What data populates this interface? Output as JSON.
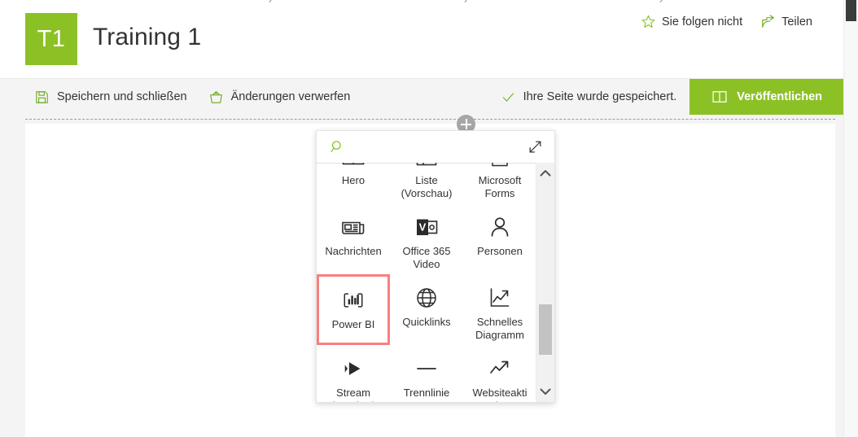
{
  "window": {
    "clipped_top_text": "..."
  },
  "site_header": {
    "logo_initials": "T1",
    "logo_color": "#8cc126",
    "title": "Training 1",
    "actions": [
      {
        "label": "Sie folgen nicht",
        "icon": "star-outline-icon"
      },
      {
        "label": "Teilen",
        "icon": "share-icon"
      }
    ]
  },
  "command_bar": {
    "items": [
      {
        "label": "Speichern und schließen",
        "icon": "save-icon"
      },
      {
        "label": "Änderungen verwerfen",
        "icon": "discard-icon"
      }
    ],
    "save_status": {
      "label": "Ihre Seite wurde gespeichert.",
      "icon": "checkmark-icon"
    },
    "publish": {
      "label": "Veröffentlichen",
      "icon": "publish-book-icon",
      "color": "#8cc126"
    }
  },
  "canvas": {
    "add_section_button": "add-section-icon"
  },
  "picker": {
    "search": {
      "value": "",
      "placeholder": "",
      "icon": "search-icon",
      "expand_icon": "expand-diagonal-icon"
    },
    "selection_color": "#f97f7f",
    "selected_index": 6,
    "webparts": [
      {
        "label": "Hero",
        "icon": "hero-icon"
      },
      {
        "label": "Liste\n(Vorschau)",
        "icon": "list-icon"
      },
      {
        "label": "Microsoft\nForms",
        "icon": "forms-icon"
      },
      {
        "label": "Nachrichten",
        "icon": "news-icon"
      },
      {
        "label": "Office 365\nVideo",
        "icon": "office-video-icon"
      },
      {
        "label": "Personen",
        "icon": "person-icon"
      },
      {
        "label": "Power BI",
        "icon": "power-bi-icon"
      },
      {
        "label": "Quicklinks",
        "icon": "globe-icon"
      },
      {
        "label": "Schnelles\nDiagramm",
        "icon": "quick-chart-icon"
      },
      {
        "label": "Stream\n(Preview)",
        "icon": "stream-play-icon"
      },
      {
        "label": "Trennlinie",
        "icon": "divider-line-icon"
      },
      {
        "label": "Websiteakti\nvität",
        "icon": "site-activity-icon"
      }
    ],
    "scrollbar": {
      "up_icon": "chevron-up-icon",
      "down_icon": "chevron-down-icon"
    }
  },
  "browser_scrollbar": {
    "up_icon": "chevron-up-icon"
  }
}
